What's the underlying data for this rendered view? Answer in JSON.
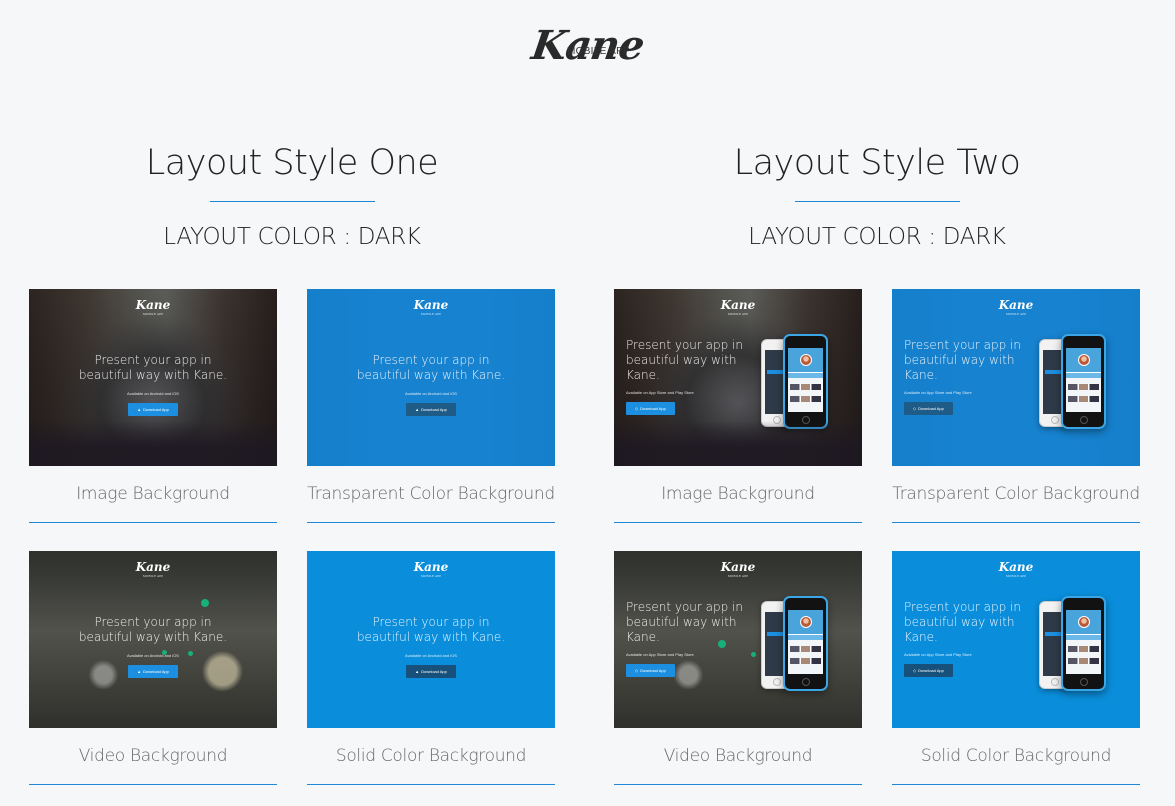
{
  "brand": {
    "logo_text": "Kane",
    "logo_subtitle": "MOBILE APP"
  },
  "accent_color": "#1e88d4",
  "columns": [
    {
      "title": "Layout Style One",
      "subtitle": "LAYOUT COLOR : DARK",
      "cards": [
        {
          "label": "Image Background",
          "preview": {
            "logo": "Kane",
            "logo_sub": "MOBILE APP",
            "headline": "Present your app in beautiful way with Kane.",
            "sub": "Available on Android and iOS",
            "button": "Download App",
            "button_icon": "android-icon"
          }
        },
        {
          "label": "Transparent Color Background",
          "preview": {
            "logo": "Kane",
            "logo_sub": "MOBILE APP",
            "headline": "Present your app in beautiful way with Kane.",
            "sub": "Available on Android and iOS",
            "button": "Download App",
            "button_icon": "android-icon"
          }
        },
        {
          "label": "Video Background",
          "preview": {
            "logo": "Kane",
            "logo_sub": "MOBILE APP",
            "headline": "Present your app in beautiful way with Kane.",
            "sub": "Available on Android and iOS",
            "button": "Download App",
            "button_icon": "android-icon"
          }
        },
        {
          "label": "Solid Color Background",
          "preview": {
            "logo": "Kane",
            "logo_sub": "MOBILE APP",
            "headline": "Present your app in beautiful way with Kane.",
            "sub": "Available on Android and iOS",
            "button": "Download App",
            "button_icon": "android-icon"
          }
        }
      ]
    },
    {
      "title": "Layout Style Two",
      "subtitle": "LAYOUT COLOR : DARK",
      "cards": [
        {
          "label": "Image Background",
          "preview": {
            "logo": "Kane",
            "logo_sub": "MOBILE APP",
            "headline": "Present your app in beautiful way with Kane.",
            "sub": "Available on App Store and Play Store",
            "button": "Download App",
            "button_icon": "diamond-icon"
          }
        },
        {
          "label": "Transparent Color Background",
          "preview": {
            "logo": "Kane",
            "logo_sub": "MOBILE APP",
            "headline": "Present your app in beautiful way with Kane.",
            "sub": "Available on App Store and Play Store",
            "button": "Download App",
            "button_icon": "diamond-icon"
          }
        },
        {
          "label": "Video Background",
          "preview": {
            "logo": "Kane",
            "logo_sub": "MOBILE APP",
            "headline": "Present your app in beautiful way with Kane.",
            "sub": "Available on App Store and Play Store",
            "button": "Download App",
            "button_icon": "diamond-icon"
          }
        },
        {
          "label": "Solid Color Background",
          "preview": {
            "logo": "Kane",
            "logo_sub": "MOBILE APP",
            "headline": "Present your app in beautiful way with Kane.",
            "sub": "Available on App Store and Play Store",
            "button": "Download App",
            "button_icon": "diamond-icon"
          }
        }
      ]
    }
  ]
}
